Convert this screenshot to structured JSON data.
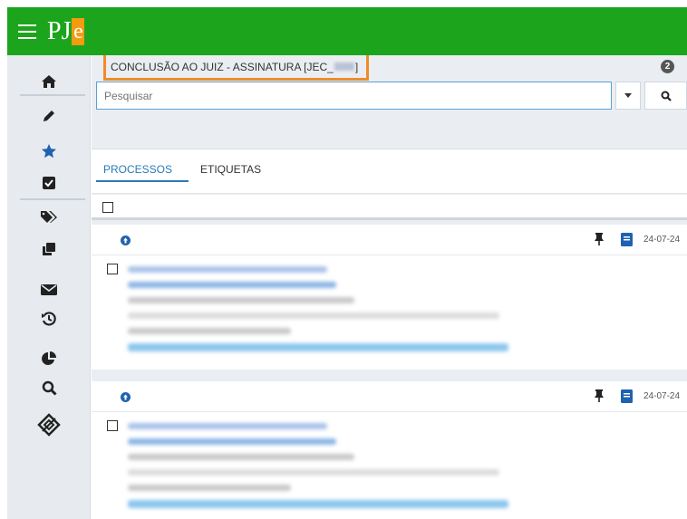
{
  "app": {
    "logo_text": "PJ",
    "logo_accent": "e"
  },
  "colors": {
    "topbar": "#1ca51c",
    "accent_orange": "#f08c27",
    "link_blue": "#2a7ab8",
    "sidebar_bg": "#e7ebef"
  },
  "sidebar": {
    "items": [
      {
        "icon": "home-icon"
      },
      {
        "icon": "pencil-icon"
      },
      {
        "icon": "star-icon"
      },
      {
        "icon": "checkbox-icon"
      },
      {
        "icon": "tags-icon"
      },
      {
        "icon": "copy-icon"
      },
      {
        "icon": "envelope-icon"
      },
      {
        "icon": "history-icon"
      },
      {
        "icon": "pie-chart-icon"
      },
      {
        "icon": "search-icon"
      },
      {
        "icon": "diamond-sign-icon"
      }
    ]
  },
  "header": {
    "task_title_prefix": "CONCLUSÃO AO JUIZ - ASSINATURA [JEC_",
    "task_title_suffix": "]",
    "count": "2"
  },
  "search": {
    "placeholder": "Pesquisar"
  },
  "tabs": [
    {
      "label": "PROCESSOS",
      "active": true
    },
    {
      "label": "ETIQUETAS",
      "active": false
    }
  ],
  "processes": [
    {
      "date": "24-07-24"
    },
    {
      "date": "24-07-24"
    }
  ]
}
